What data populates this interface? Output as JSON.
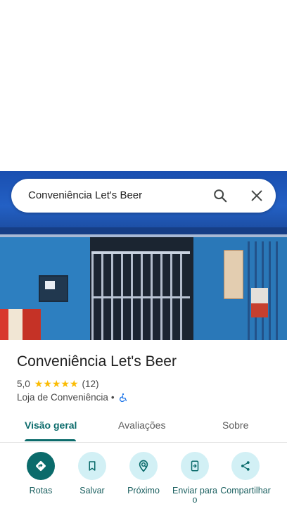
{
  "search": {
    "query": "Conveniência Let's Beer"
  },
  "place": {
    "name": "Conveniência Let's Beer",
    "rating": "5,0",
    "stars": "★★★★★",
    "review_count": "(12)",
    "category": "Loja de Conveniência",
    "separator": "•"
  },
  "tabs": [
    {
      "label": "Visão geral"
    },
    {
      "label": "Avaliações"
    },
    {
      "label": "Sobre"
    }
  ],
  "actions": [
    {
      "label": "Rotas",
      "icon": "directions-icon"
    },
    {
      "label": "Salvar",
      "icon": "bookmark-icon"
    },
    {
      "label": "Próximo",
      "icon": "nearby-icon"
    },
    {
      "label": "Enviar para o",
      "icon": "send-to-phone-icon"
    },
    {
      "label": "Compartilhar",
      "icon": "share-icon"
    }
  ],
  "colors": {
    "accent": "#0b6b6b",
    "action_bg": "#d2f0f5",
    "star": "#fbbc04"
  }
}
